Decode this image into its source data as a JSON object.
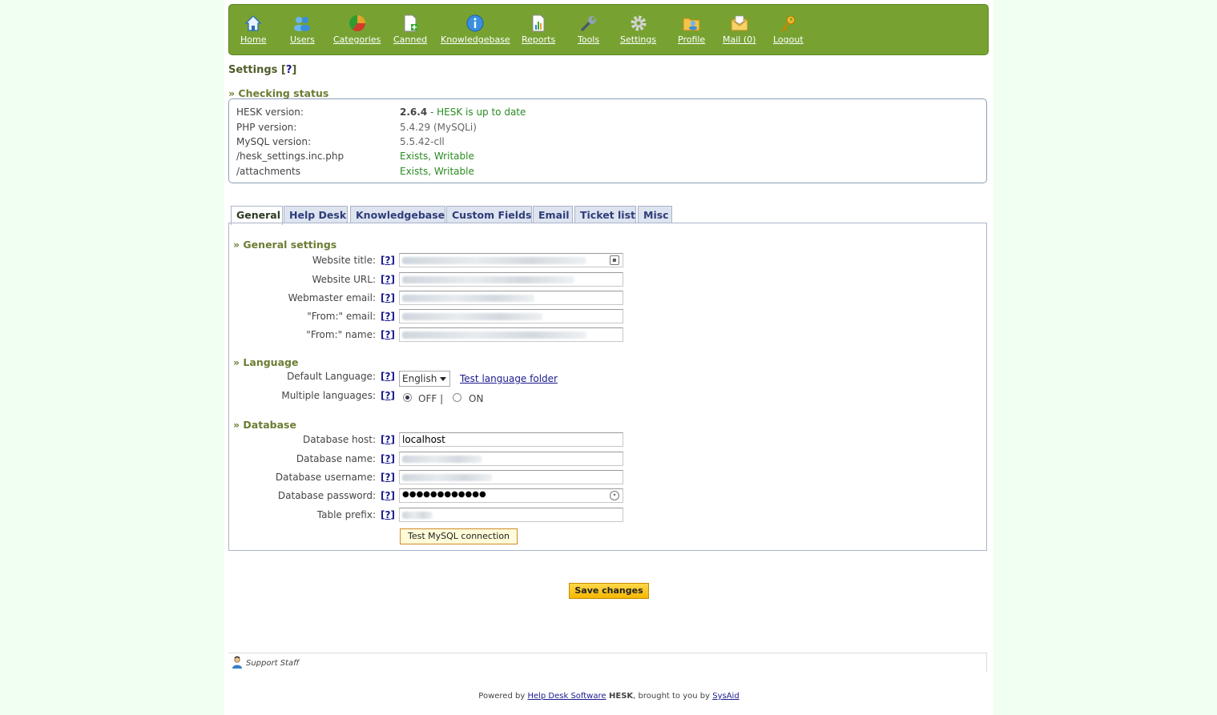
{
  "nav": {
    "items": [
      {
        "label": "Home",
        "icon": "home-icon"
      },
      {
        "label": "Users",
        "icon": "users-icon"
      },
      {
        "label": "Categories",
        "icon": "categories-icon"
      },
      {
        "label": "Canned",
        "icon": "canned-icon"
      },
      {
        "label": "Knowledgebase",
        "icon": "info-icon"
      },
      {
        "label": "Reports",
        "icon": "reports-icon"
      },
      {
        "label": "Tools",
        "icon": "wrench-icon"
      },
      {
        "label": "Settings",
        "icon": "gear-icon"
      },
      {
        "label": "Profile",
        "icon": "profile-icon"
      },
      {
        "label": "Mail (0)",
        "icon": "mail-icon"
      },
      {
        "label": "Logout",
        "icon": "key-icon"
      }
    ]
  },
  "page": {
    "title": "Settings [",
    "title_help": "?",
    "title_end": "]"
  },
  "status": {
    "heading": "» Checking status",
    "rows": [
      {
        "label": "HESK version:",
        "value": "2.6.4",
        "extra": " - HESK is up to date"
      },
      {
        "label": "PHP version:",
        "value": "5.4.29 (MySQLi)"
      },
      {
        "label": "MySQL version:",
        "value": "5.5.42-cll"
      },
      {
        "label": "/hesk_settings.inc.php",
        "value": "Exists, Writable"
      },
      {
        "label": "/attachments",
        "value": "Exists, Writable"
      }
    ]
  },
  "tabs": [
    "General",
    "Help Desk",
    "Knowledgebase",
    "Custom Fields",
    "Email",
    "Ticket list",
    "Misc"
  ],
  "general": {
    "heading": "» General settings",
    "fields": [
      {
        "label": "Website title:"
      },
      {
        "label": "Website URL:"
      },
      {
        "label": "Webmaster email:"
      },
      {
        "label": "\"From:\" email:"
      },
      {
        "label": "\"From:\" name:"
      }
    ]
  },
  "language": {
    "heading": "» Language",
    "default_label": "Default Language:",
    "default_value": "English",
    "test_link": "Test language folder",
    "multiple_label": "Multiple languages:",
    "off": "OFF |",
    "on": "ON",
    "multiple_value": "OFF"
  },
  "database": {
    "heading": "» Database",
    "host_label": "Database host:",
    "host_value": "localhost",
    "name_label": "Database name:",
    "user_label": "Database username:",
    "pass_label": "Database password:",
    "pass_value": "●●●●●●●●●●●●",
    "prefix_label": "Table prefix:",
    "test_button": "Test MySQL connection"
  },
  "help_mark": "?",
  "save_button": "Save changes",
  "footer": {
    "staff": "Support Staff",
    "powered_pre": "Powered by ",
    "powered_link": "Help Desk Software",
    "powered_brand": " HESK",
    "powered_mid": ", brought to you by ",
    "powered_link2": "SysAid"
  },
  "colors": {
    "nav_bg": "#77a232",
    "page_bg": "#f0fff0",
    "heading": "#6b7d33",
    "ok_green": "#2a8a21",
    "link": "#1a1a8e",
    "save_button": "#f5b700"
  }
}
